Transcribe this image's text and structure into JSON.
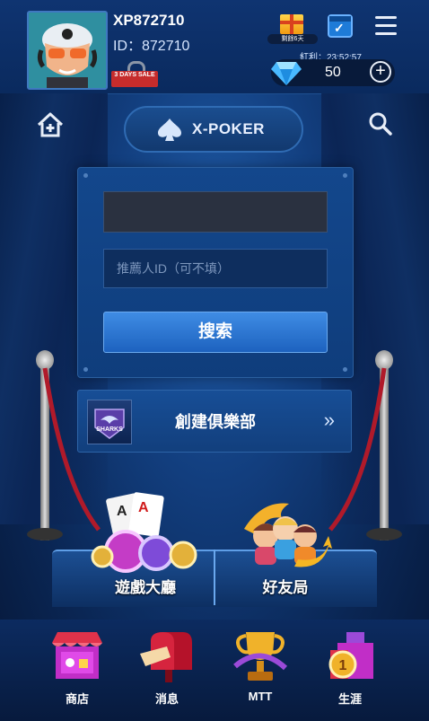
{
  "header": {
    "username": "XP872710",
    "user_id": "ID：872710",
    "sale_badge": "3 DAYS SALE",
    "gift_label": "剩餘6天",
    "bonus_timer": "紅利：23:52:57",
    "gem_count": "50"
  },
  "logo": {
    "text": "X-POKER"
  },
  "form": {
    "ref_placeholder": "推薦人ID（可不填）",
    "search_label": "搜索"
  },
  "club": {
    "label": "創建俱樂部",
    "chevrons": "»",
    "badge_text": "SHARKS"
  },
  "stage": {
    "lobby_label": "遊戲大廳",
    "friends_label": "好友局"
  },
  "nav": {
    "items": [
      {
        "label": "商店"
      },
      {
        "label": "消息"
      },
      {
        "label": "MTT"
      },
      {
        "label": "生涯"
      }
    ]
  },
  "colors": {
    "accent": "#3f8ce4",
    "background": "#123e7e"
  }
}
